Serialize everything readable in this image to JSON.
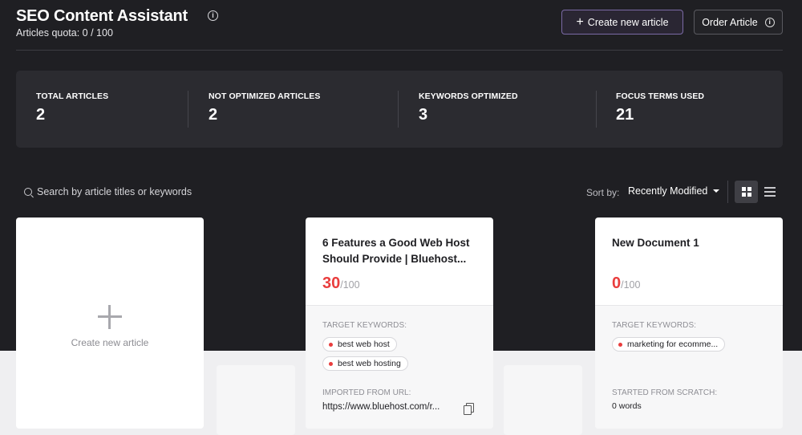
{
  "header": {
    "title": "SEO Content Assistant",
    "quota": "Articles quota: 0 / 100",
    "create_button": "Create new article",
    "order_button": "Order Article"
  },
  "stats": [
    {
      "label": "TOTAL ARTICLES",
      "value": "2"
    },
    {
      "label": "NOT OPTIMIZED ARTICLES",
      "value": "2"
    },
    {
      "label": "KEYWORDS OPTIMIZED",
      "value": "3"
    },
    {
      "label": "FOCUS TERMS USED",
      "value": "21"
    }
  ],
  "toolbar": {
    "search_placeholder": "Search by article titles or keywords",
    "sort_label": "Sort by:",
    "sort_value": "Recently Modified"
  },
  "new_card": {
    "label": "Create new article"
  },
  "articles": [
    {
      "title_line1": "6 Features a Good Web Host",
      "title_line2": "Should Provide | Bluehost...",
      "score": "30",
      "score_max": "/100",
      "keywords_label": "TARGET KEYWORDS:",
      "keywords": [
        "best web host",
        "best web hosting"
      ],
      "source_label": "IMPORTED FROM URL:",
      "source_value": "https://www.bluehost.com/r..."
    },
    {
      "title_line1": "New Document 1",
      "score": "0",
      "score_max": "/100",
      "keywords_label": "TARGET KEYWORDS:",
      "keywords": [
        "marketing for ecomme..."
      ],
      "source_label": "STARTED FROM SCRATCH:",
      "source_value": "0 words"
    }
  ],
  "colors": {
    "background": "#1f1f23",
    "panel": "#2b2b30",
    "score_red": "#e93d3d",
    "accent_border": "#7b6aa6"
  }
}
